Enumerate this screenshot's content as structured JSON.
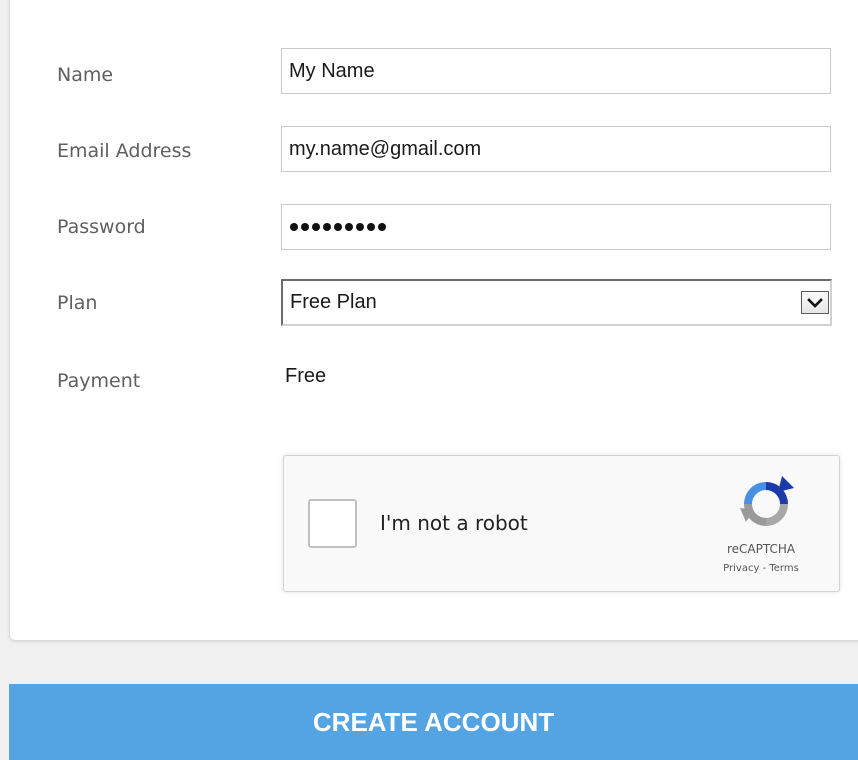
{
  "form": {
    "name": {
      "label": "Name",
      "value": "My Name"
    },
    "email": {
      "label": "Email Address",
      "value": "my.name@gmail.com"
    },
    "password": {
      "label": "Password",
      "masked_length": 9
    },
    "plan": {
      "label": "Plan",
      "selected": "Free Plan"
    },
    "payment": {
      "label": "Payment",
      "value": "Free"
    }
  },
  "captcha": {
    "checkbox_label": "I'm not a robot",
    "brand": "reCAPTCHA",
    "privacy_label": "Privacy",
    "separator": " - ",
    "terms_label": "Terms",
    "checked": false
  },
  "actions": {
    "create_account_label": "CREATE ACCOUNT"
  },
  "colors": {
    "primary_button": "#54a3e3",
    "page_background": "#f1f1f1"
  },
  "icons": [
    "chevron-down-icon",
    "recaptcha-logo-icon"
  ]
}
